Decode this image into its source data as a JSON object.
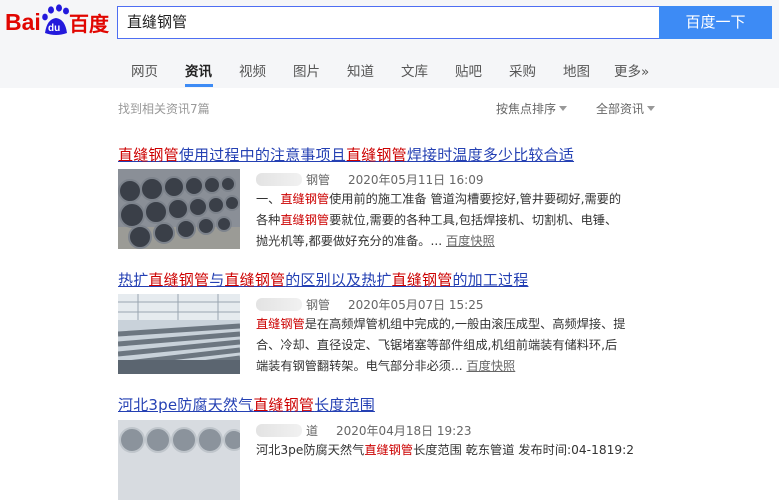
{
  "header": {
    "logo_text_left": "Bai",
    "logo_paw_text": "du",
    "logo_text_right": "百度",
    "search_query": "直缝钢管",
    "search_button": "百度一下"
  },
  "tabs": [
    "网页",
    "资讯",
    "视频",
    "图片",
    "知道",
    "文库",
    "贴吧",
    "采购",
    "地图",
    "更多»"
  ],
  "active_tab": "资讯",
  "results_meta": {
    "count_text": "找到相关资讯7篇",
    "sort_label": "按焦点排序",
    "filter_label": "全部资讯"
  },
  "results": [
    {
      "title_parts": [
        "直缝钢管",
        "使用过程中的注意事项且",
        "直缝钢管",
        "焊接时温度多少比较合适"
      ],
      "source_suffix": "钢管",
      "date": "2020年05月11日 16:09",
      "snippet_lines": [
        [
          "",
          "一、",
          "直缝钢管",
          "使用前的施工准备 管道沟槽要挖好,管井要砌好,需要的"
        ],
        [
          "",
          "各种",
          "直缝钢管",
          "要就位,需要的各种工具,包括焊接机、切割机、电锤、"
        ],
        [
          "",
          "抛光机等,都要做好充分的准备。...",
          "",
          ""
        ]
      ],
      "cache_link": "百度快照"
    },
    {
      "title_parts": [
        "热扩",
        "直缝钢管",
        "与",
        "直缝钢管",
        "的区别以及热扩",
        "直缝钢管",
        "的加工过程"
      ],
      "source_suffix": "钢管",
      "date": "2020年05月07日 15:25",
      "snippet_lines": [
        [
          "",
          "",
          "直缝钢管",
          "是在高频焊管机组中完成的,一般由滚压成型、高频焊接、提"
        ],
        [
          "",
          "合、冷却、直径设定、飞锯堵塞等部件组成,机组前端装有储料环,后",
          "",
          ""
        ],
        [
          "",
          "端装有钢管翻转架。电气部分非必须...",
          "",
          ""
        ]
      ],
      "cache_link": "百度快照"
    },
    {
      "title_parts": [
        "河北3pe防腐天然气",
        "直缝钢管",
        "长度范围"
      ],
      "source_suffix": "道",
      "date": "2020年04月18日 19:23",
      "snippet_lines": [
        [
          "",
          "河北3pe防腐天然气",
          "直缝钢管",
          "长度范围 乾东管道 发布时间:04-1819:2"
        ]
      ],
      "cache_link": ""
    }
  ],
  "colors": {
    "header_bg": "#f5f6f8",
    "brand_red": "#e10601",
    "brand_blue": "#2319dc",
    "button_blue": "#3d8bf5",
    "link_blue": "#2440b3",
    "highlight_red": "#cc0000"
  }
}
